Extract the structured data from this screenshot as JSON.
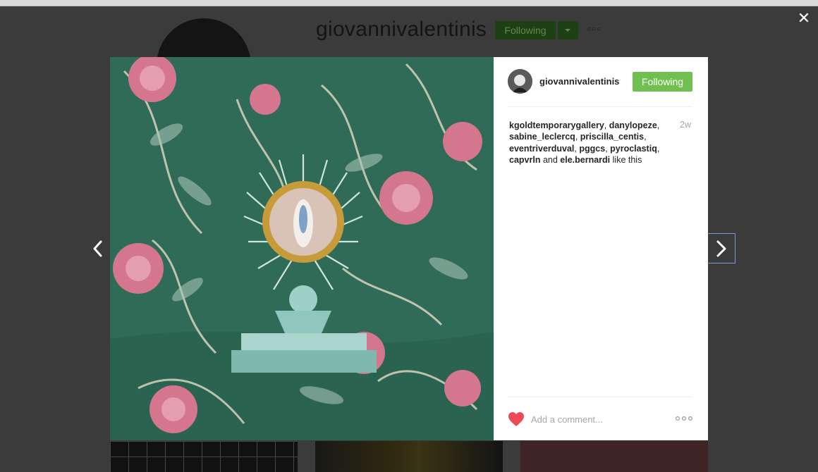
{
  "background_profile": {
    "username": "giovannivalentinis",
    "follow_label": "Following"
  },
  "modal": {
    "close_glyph": "✕",
    "post": {
      "username": "giovannivalentinis",
      "follow_label": "Following",
      "timestamp": "2w",
      "likers": [
        "kgoldtemporarygallery",
        "danylopeze",
        "sabine_leclercq",
        "priscilla_centis",
        "eventriverduval",
        "pggcs",
        "pyroclastiq",
        "capvrln"
      ],
      "likes_and": "and",
      "last_liker": "ele.bernardi",
      "likes_suffix": "like this",
      "comment_placeholder": "Add a comment..."
    },
    "icons": {
      "close": "close-icon",
      "prev": "chevron-left-icon",
      "next": "chevron-right-icon",
      "like": "heart-icon",
      "more": "more-options-icon",
      "dropdown": "caret-down-icon"
    }
  },
  "colors": {
    "follow_green": "#70c050",
    "like_red": "#ed4956",
    "overlay": "#3b3b3b"
  }
}
